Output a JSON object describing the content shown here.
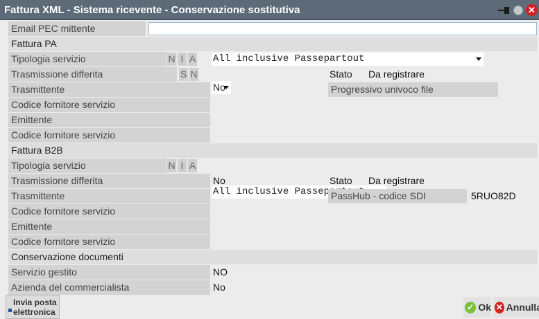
{
  "window": {
    "title": "Fattura XML - Sistema ricevente - Conservazione sostitutiva"
  },
  "email": {
    "label": "Email PEC mittente",
    "value": ""
  },
  "fattura_pa": {
    "section": "Fattura PA",
    "tipologia_label": "Tipologia servizio",
    "tipologia_letters": [
      "N",
      "I",
      "A"
    ],
    "tipologia_value": "All inclusive Passepartout",
    "trasm_diff_label": "Trasmissione differita",
    "trasm_diff_letters": [
      "S",
      "N"
    ],
    "trasm_diff_value": "No",
    "stato_label": "Stato",
    "stato_value": "Da registrare",
    "trasmittente_label": "Trasmittente",
    "progressivo_label": "Progressivo univoco file",
    "codice_fornitore_label_1": "Codice fornitore servizio",
    "emittente_label": "Emittente",
    "codice_fornitore_label_2": "Codice fornitore servizio"
  },
  "fattura_b2b": {
    "section": "Fattura B2B",
    "tipologia_label": "Tipologia servizio",
    "tipologia_letters": [
      "N",
      "I",
      "A"
    ],
    "tipologia_value": "All inclusive Passepartout",
    "trasm_diff_label": "Trasmissione differita",
    "trasm_diff_value": "No",
    "stato_label": "Stato",
    "stato_value": "Da registrare",
    "trasmittente_label": "Trasmittente",
    "passhub_label": "PassHub - codice SDI",
    "passhub_value": "5RUO82D",
    "codice_fornitore_label_1": "Codice fornitore servizio",
    "emittente_label": "Emittente",
    "codice_fornitore_label_2": "Codice fornitore servizio"
  },
  "conservazione": {
    "section": "Conservazione documenti",
    "servizio_label": "Servizio gestito",
    "servizio_value": "NO",
    "azienda_label": "Azienda del commercialista",
    "azienda_value": "No"
  },
  "footer": {
    "invia_line1": "Invia posta",
    "invia_line2": "elettronica",
    "ok_label": "Ok",
    "annulla_label": "Annulla"
  },
  "icons": {
    "pin": "pin-icon",
    "circle": "minimize-circle-icon",
    "close": "close-icon",
    "ok": "check-circle-icon",
    "annulla": "x-circle-icon"
  },
  "colors": {
    "titlebar": "#5d6a78",
    "label_bg": "#d3d3d3",
    "section_bg": "#dedede",
    "window_bg": "#ececec",
    "ok_green": "#7bbf3a",
    "cancel_red": "#d42020"
  }
}
